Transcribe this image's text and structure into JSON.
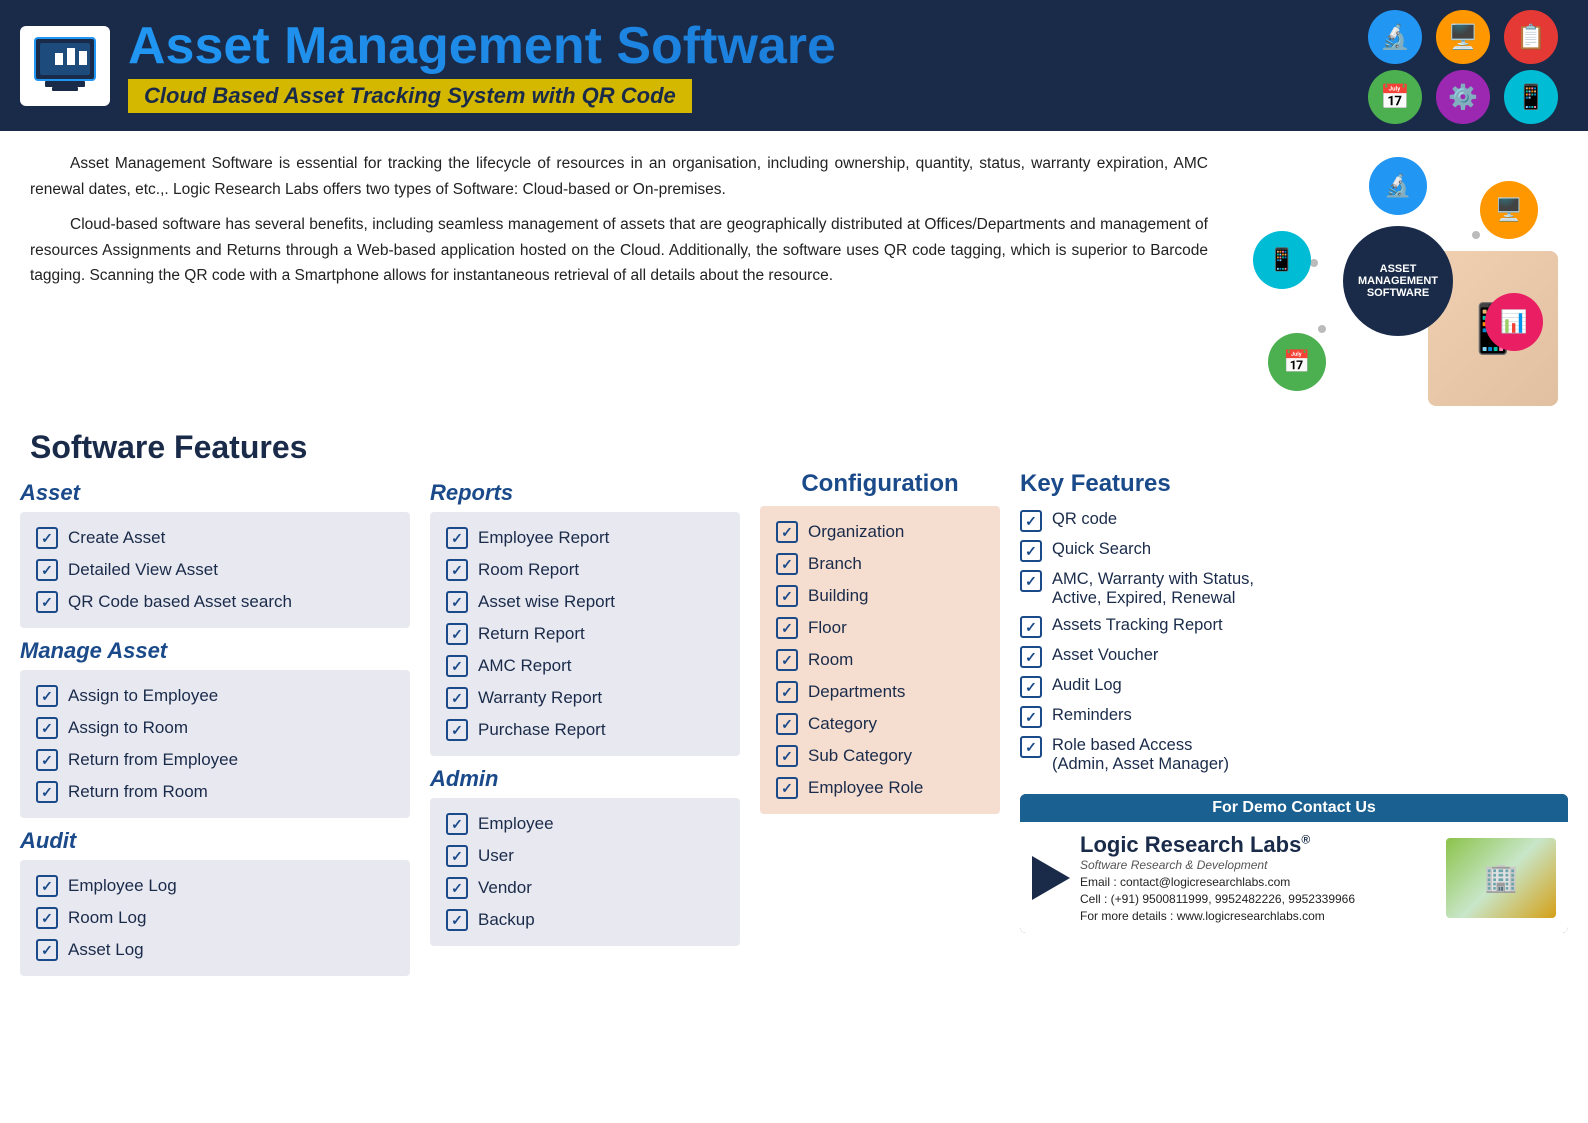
{
  "header": {
    "title": "Asset Management Software",
    "subtitle": "Cloud Based Asset Tracking System with QR Code"
  },
  "description": {
    "p1": "Asset Management Software is essential for tracking the lifecycle of resources in an organisation, including ownership, quantity, status, warranty expiration, AMC renewal dates, etc.,. Logic Research Labs offers two types of Software: Cloud-based or On-premises.",
    "p2": "Cloud-based software has several benefits, including seamless management of assets that are geographically distributed at Offices/Departments and management of resources Assignments and Returns through a Web-based application hosted on the Cloud. Additionally, the software uses QR code tagging, which is superior to Barcode tagging. Scanning the QR code with a Smartphone allows for instantaneous retrieval of all details about the resource."
  },
  "sections": {
    "softwareFeatures": "Software Features",
    "asset": {
      "title": "Asset",
      "items": [
        "Create Asset",
        "Detailed View Asset",
        "QR Code based Asset search"
      ]
    },
    "manageAsset": {
      "title": "Manage Asset",
      "items": [
        "Assign to Employee",
        "Assign to Room",
        "Return from Employee",
        "Return from Room"
      ]
    },
    "audit": {
      "title": "Audit",
      "items": [
        "Employee Log",
        "Room Log",
        "Asset Log"
      ]
    },
    "reports": {
      "title": "Reports",
      "items": [
        "Employee Report",
        "Room Report",
        "Asset wise Report",
        "Return Report",
        "AMC Report",
        "Warranty Report",
        "Purchase Report"
      ]
    },
    "admin": {
      "title": "Admin",
      "items": [
        "Employee",
        "User",
        "Vendor",
        "Backup"
      ]
    },
    "configuration": {
      "title": "Configuration",
      "items": [
        "Organization",
        "Branch",
        "Building",
        "Floor",
        "Room",
        "Departments",
        "Category",
        "Sub Category",
        "Employee Role"
      ]
    },
    "keyFeatures": {
      "title": "Key Features",
      "items": [
        "QR code",
        "Quick Search",
        "AMC, Warranty with Status, Active, Expired, Renewal",
        "Assets Tracking Report",
        "Asset Voucher",
        "Audit Log",
        "Reminders",
        "Role based Access (Admin, Asset Manager)"
      ]
    }
  },
  "contact": {
    "demo": "For Demo Contact Us",
    "brand": "Logic Research Labs",
    "trademark": "®",
    "tagline": "Software Research & Development",
    "email": "Email : contact@logicresearchlabs.com",
    "cell": "Cell   : (+91) 9500811999, 9952482226, 9952339966",
    "web": "For more details : www.logicresearchlabs.com"
  },
  "diagramCenter": "ASSET\nMANAGEMENT\nSOFTWARE",
  "nodeColors": {
    "n1": "#2196F3",
    "n2": "#FF9800",
    "n3": "#E91E63",
    "n4": "#4CAF50",
    "n5": "#00BCD4",
    "n6": "#9C27B0"
  }
}
